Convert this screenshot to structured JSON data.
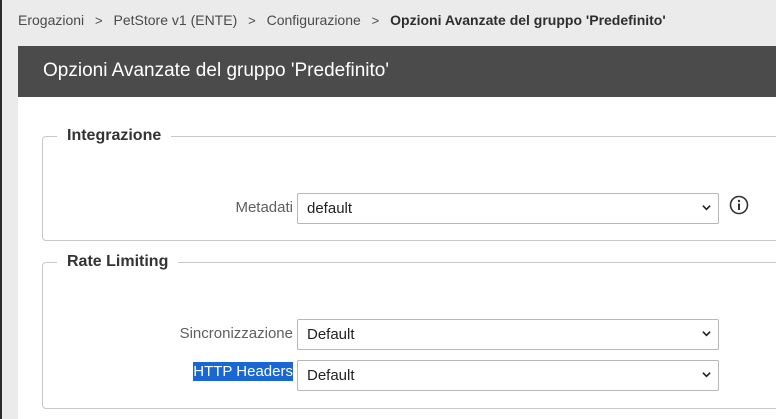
{
  "breadcrumb": {
    "items": [
      "Erogazioni",
      "PetStore v1 (ENTE)",
      "Configurazione"
    ],
    "current": "Opzioni Avanzate del gruppo 'Predefinito'"
  },
  "panel": {
    "title": "Opzioni Avanzate del gruppo 'Predefinito'"
  },
  "integrazione": {
    "legend": "Integrazione",
    "metadati_label": "Metadati",
    "metadati_value": "default"
  },
  "rate_limiting": {
    "legend": "Rate Limiting",
    "sincronizzazione_label": "Sincronizzazione",
    "sincronizzazione_value": "Default",
    "http_headers_label": "HTTP Headers",
    "http_headers_value": "Default"
  },
  "icons": {
    "info": "info-circle-icon",
    "dropdown": "chevron-down-icon",
    "separator": "chevron-right-icon"
  }
}
